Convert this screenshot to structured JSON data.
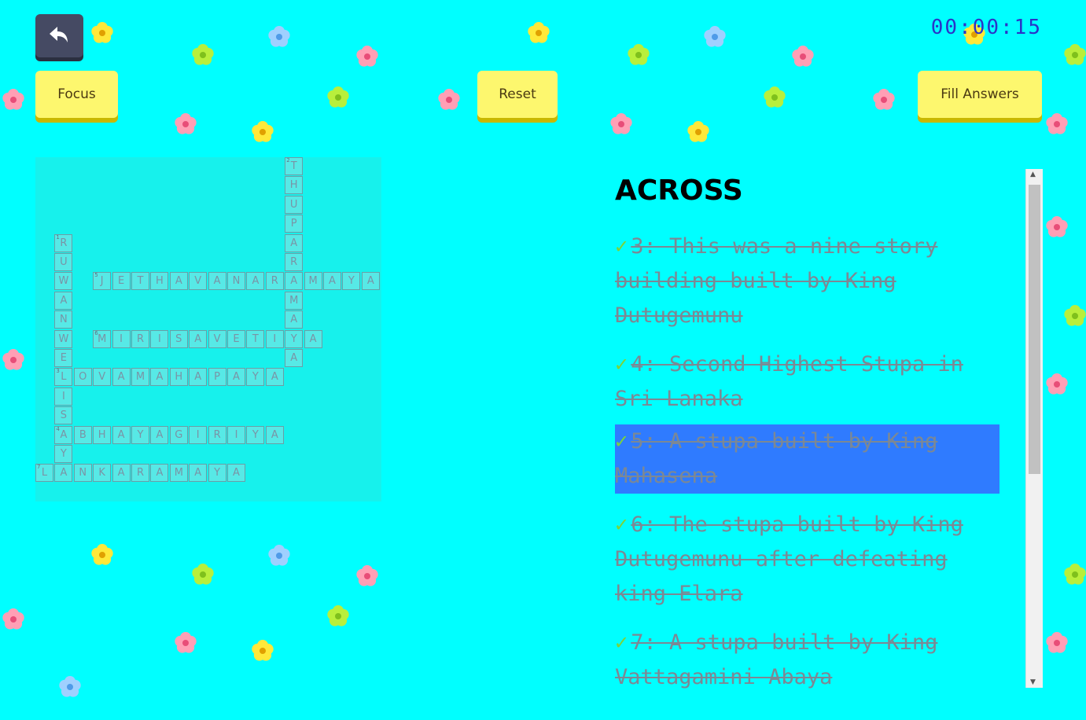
{
  "toolbar": {
    "undo_icon": "undo-arrow-icon",
    "focus_label": "Focus",
    "reset_label": "Reset",
    "fill_label": "Fill Answers",
    "timer": "00:00:15"
  },
  "colors": {
    "background": "#00ffff",
    "button": "#fdf76e",
    "timer": "#2b33c8",
    "selected_clue": "#2f7bff",
    "check": "#7cd33a"
  },
  "crossword": {
    "words": [
      {
        "number": "1",
        "answer": "RUWANWELISAYA",
        "dir": "down",
        "row": 4,
        "col": 1
      },
      {
        "number": "2",
        "answer": "THUPARAMAYA",
        "dir": "down",
        "row": 0,
        "col": 13
      },
      {
        "number": "3",
        "answer": "LOVAMAHAPAYA",
        "dir": "across",
        "row": 11,
        "col": 1
      },
      {
        "number": "4",
        "answer": "ABHAYAGIRIYA",
        "dir": "across",
        "row": 14,
        "col": 1
      },
      {
        "number": "5",
        "answer": "JETHAVANARAMAYA",
        "dir": "across",
        "row": 6,
        "col": 3
      },
      {
        "number": "6",
        "answer": "MIRISAVETIYA",
        "dir": "across",
        "row": 9,
        "col": 3
      },
      {
        "number": "7",
        "answer": "LANKARAMAYA",
        "dir": "across",
        "row": 16,
        "col": 0
      }
    ]
  },
  "clues": {
    "title": "ACROSS",
    "check_mark": "✓",
    "items": [
      {
        "text": "3: This was a nine story building built by King Dutugemunu",
        "selected": false
      },
      {
        "text": "4: Second Highest Stupa in Sri Lanaka",
        "selected": false
      },
      {
        "text": "5: A stupa built by King Mahasena",
        "selected": true
      },
      {
        "text": "6: The stupa built by King Dutugemunu after defeating king Elara",
        "selected": false
      },
      {
        "text": "7: A stupa built by King Vattagamini Abaya",
        "selected": false
      }
    ]
  }
}
